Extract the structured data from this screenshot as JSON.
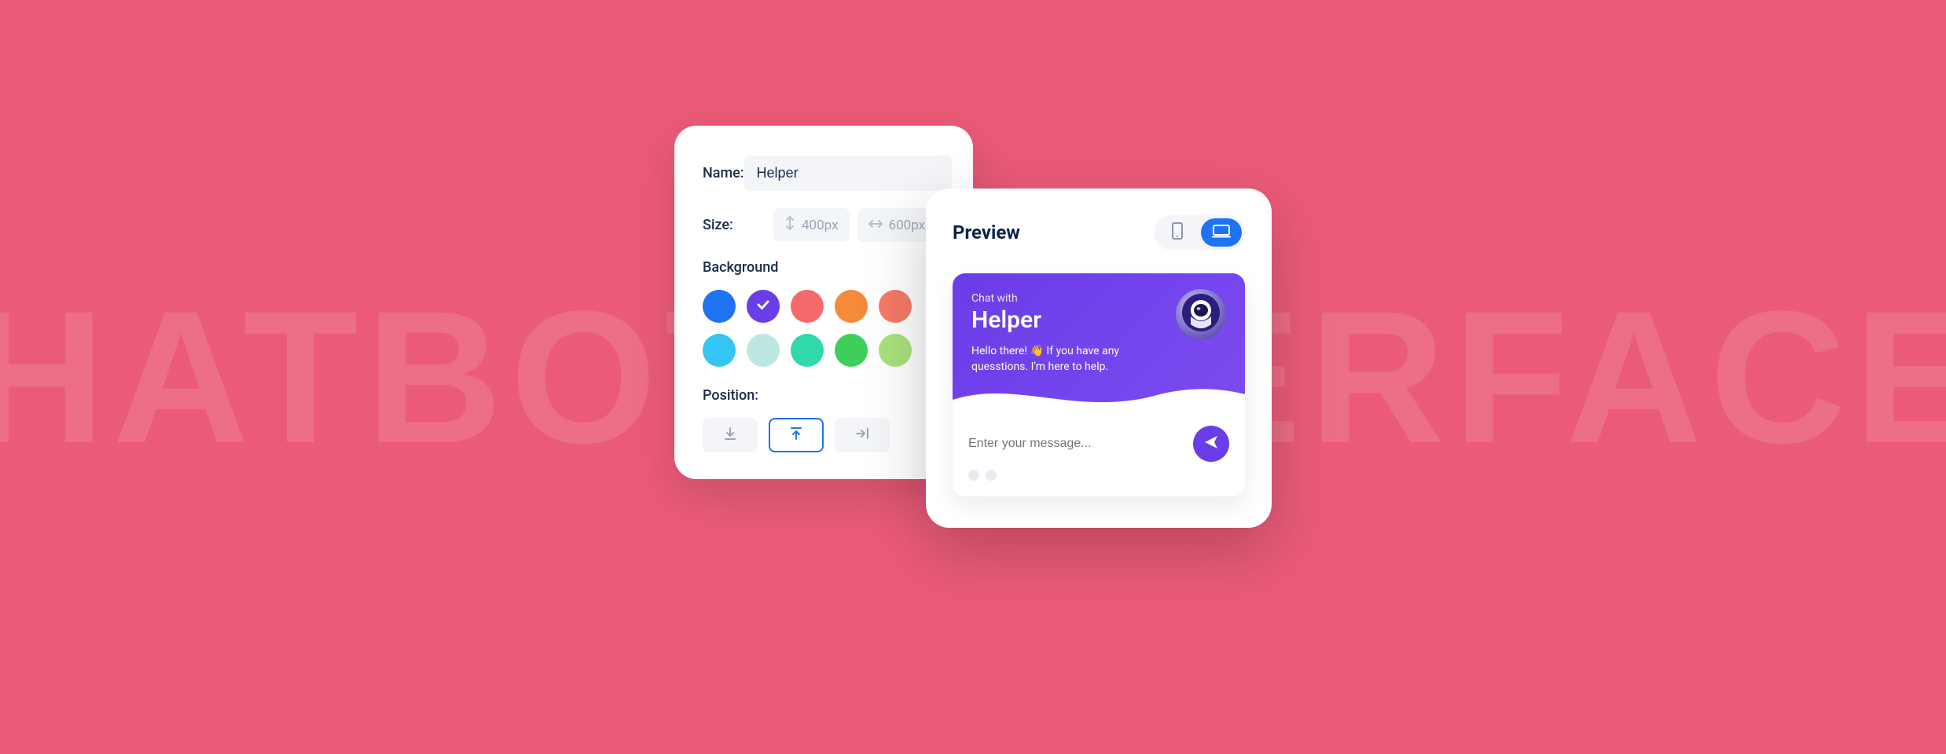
{
  "bg_text": "CHATBOT INTERFACES",
  "settings": {
    "name_label": "Name:",
    "name_value": "Helper",
    "size_label": "Size:",
    "size_h_value": "400px",
    "size_w_value": "600px",
    "background_label": "Background",
    "position_label": "Position:",
    "swatches": [
      {
        "color": "#1e73f2"
      },
      {
        "color": "#6a3de8",
        "selected": true
      },
      {
        "color": "#f46a6a"
      },
      {
        "color": "#f58a3a"
      },
      {
        "color": "#f57a66"
      },
      {
        "color": "#33c6f4"
      },
      {
        "color": "#bde7e3"
      },
      {
        "color": "#2fd9a8"
      },
      {
        "color": "#3dcf5a"
      },
      {
        "color": "#a8e27a"
      }
    ],
    "positions": [
      "bottom",
      "top",
      "right"
    ],
    "position_active": "top"
  },
  "preview": {
    "title": "Preview",
    "device_active": "desktop",
    "chat": {
      "chat_with_label": "Chat with",
      "name": "Helper",
      "greeting": "Hello there! 👋 If you have any quesstions. I'm here to help.",
      "input_placeholder": "Enter your message..."
    }
  }
}
